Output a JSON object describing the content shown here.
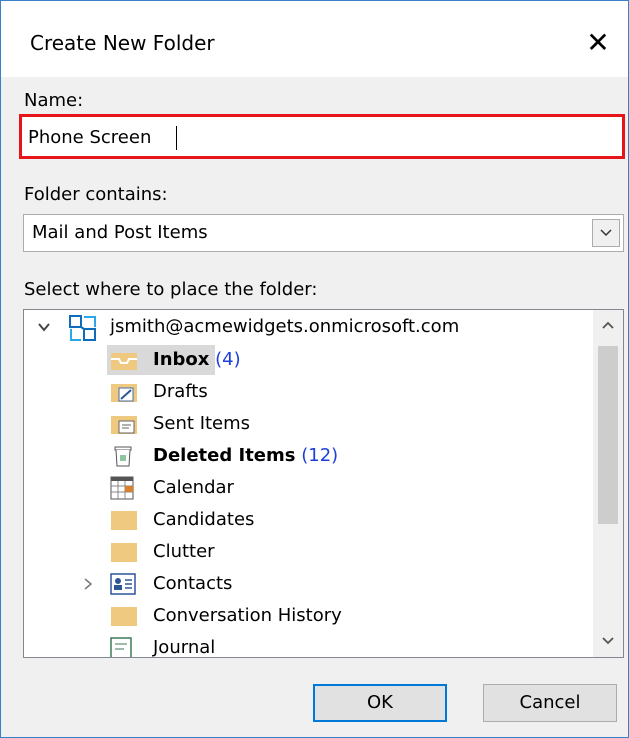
{
  "dialog": {
    "title": "Create New Folder",
    "close_glyph": "✕"
  },
  "name": {
    "label": "Name:",
    "value": "Phone Screen"
  },
  "folder_contains": {
    "label": "Folder contains:",
    "value": "Mail and Post Items"
  },
  "tree": {
    "label": "Select where to place the folder:",
    "account": "jsmith@acmewidgets.onmicrosoft.com",
    "items": [
      {
        "label": "Inbox",
        "count": "(4)",
        "bold": true,
        "selected": true,
        "icon": "inbox-icon"
      },
      {
        "label": "Drafts",
        "count": "",
        "icon": "drafts-icon"
      },
      {
        "label": "Sent Items",
        "count": "",
        "icon": "sent-items-icon"
      },
      {
        "label": "Deleted Items",
        "count": "(12)",
        "bold": true,
        "icon": "trash-icon"
      },
      {
        "label": "Calendar",
        "count": "",
        "icon": "calendar-icon"
      },
      {
        "label": "Candidates",
        "count": "",
        "icon": "folder-icon"
      },
      {
        "label": "Clutter",
        "count": "",
        "icon": "folder-icon"
      },
      {
        "label": "Contacts",
        "count": "",
        "icon": "contacts-icon"
      },
      {
        "label": "Conversation History",
        "count": "",
        "icon": "folder-icon"
      },
      {
        "label": "Journal",
        "count": "",
        "icon": "journal-icon"
      }
    ]
  },
  "buttons": {
    "ok": "OK",
    "cancel": "Cancel"
  },
  "colors": {
    "accent": "#0078d7",
    "error_border": "#e8141c",
    "count": "#1b3fd8",
    "folder": "#efc97f"
  }
}
